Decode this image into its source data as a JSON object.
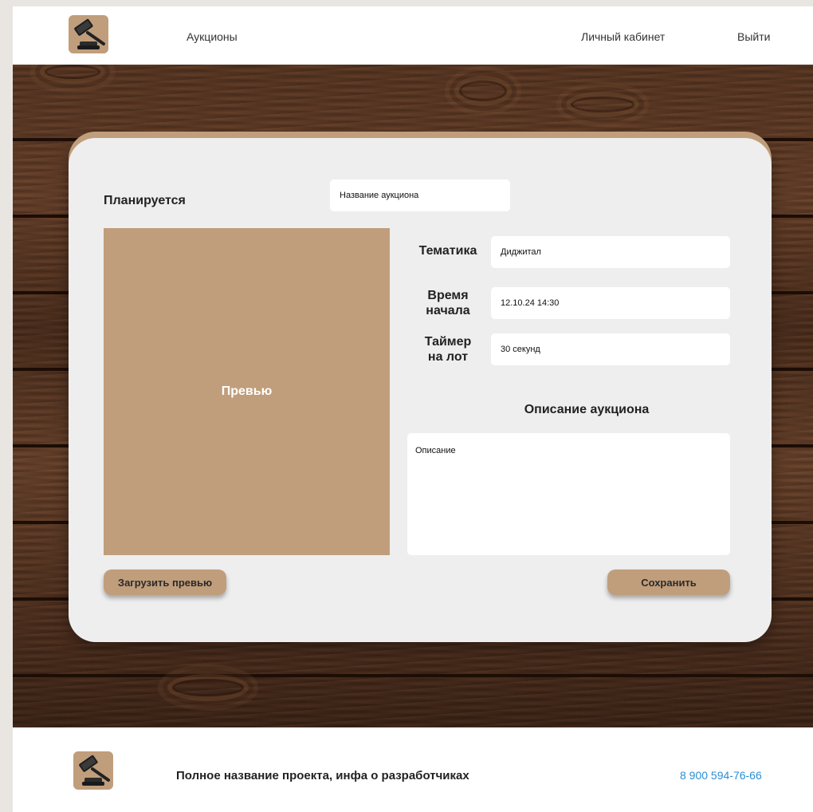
{
  "header": {
    "nav_auctions": "Аукционы",
    "nav_cabinet": "Личный кабинет",
    "nav_logout": "Выйти"
  },
  "form": {
    "status": "Планируется",
    "name_value": "Название аукциона",
    "preview_label": "Превью",
    "theme_label": "Тематика",
    "theme_value": "Диджитал",
    "start_time_label_line1": "Время",
    "start_time_label_line2": "начала",
    "start_time_value": "12.10.24 14:30",
    "lot_timer_label_line1": "Таймер",
    "lot_timer_label_line2": "на лот",
    "lot_timer_value": "30 секунд",
    "description_title": "Описание аукциона",
    "description_value": "Описание",
    "upload_button": "Загрузить превью",
    "save_button": "Сохранить"
  },
  "footer": {
    "project_info": "Полное название проекта, инфа о разработчиках",
    "phone": "8 900 594-76-66"
  },
  "colors": {
    "accent": "#c09e7c",
    "card_bg": "#eeeeee",
    "phone_link": "#2a8fd6",
    "wood_dark": "#3e2416"
  },
  "icons": {
    "logo": "gavel-icon"
  }
}
